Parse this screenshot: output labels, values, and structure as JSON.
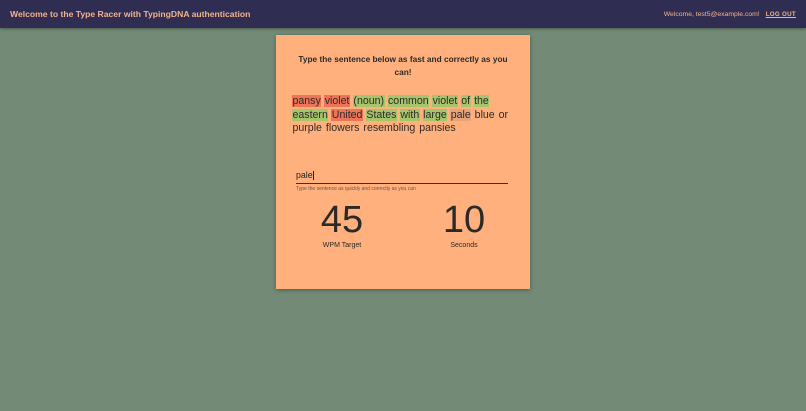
{
  "header": {
    "title": "Welcome to the Type Racer with TypingDNA authentication",
    "welcome": "Welcome, test5@example.com!",
    "logout_label": "LOG OUT"
  },
  "card": {
    "instruction": "Type the sentence below as fast and correctly as you can!",
    "sentence_words": [
      {
        "text": "pansy",
        "state": "wrong"
      },
      {
        "text": "violet",
        "state": "wrong"
      },
      {
        "text": "(noun)",
        "state": "correct"
      },
      {
        "text": "common",
        "state": "correct"
      },
      {
        "text": "violet",
        "state": "correct"
      },
      {
        "text": "of",
        "state": "correct"
      },
      {
        "text": "the",
        "state": "correct"
      },
      {
        "text": "eastern",
        "state": "correct"
      },
      {
        "text": "United",
        "state": "wrong"
      },
      {
        "text": "States",
        "state": "correct"
      },
      {
        "text": "with",
        "state": "correct"
      },
      {
        "text": "large",
        "state": "correct"
      },
      {
        "text": "pale",
        "state": "current"
      },
      {
        "text": "blue",
        "state": "pending"
      },
      {
        "text": "or",
        "state": "pending"
      },
      {
        "text": "purple",
        "state": "pending"
      },
      {
        "text": "flowers",
        "state": "pending"
      },
      {
        "text": "resembling",
        "state": "pending"
      },
      {
        "text": "pansies",
        "state": "pending"
      }
    ],
    "input_value": "pale",
    "input_helper": "Type the sentence as quickly and correctly as you can",
    "wpm_value": "45",
    "wpm_label": "WPM Target",
    "seconds_value": "10",
    "seconds_label": "Seconds"
  },
  "colors": {
    "background": "#728a76",
    "topbar": "#2f2d52",
    "accent_text": "#f2b38a",
    "card": "#ffb07c",
    "correct": "#a6c56b",
    "wrong": "#ef7356",
    "current": "#e8a37b"
  }
}
